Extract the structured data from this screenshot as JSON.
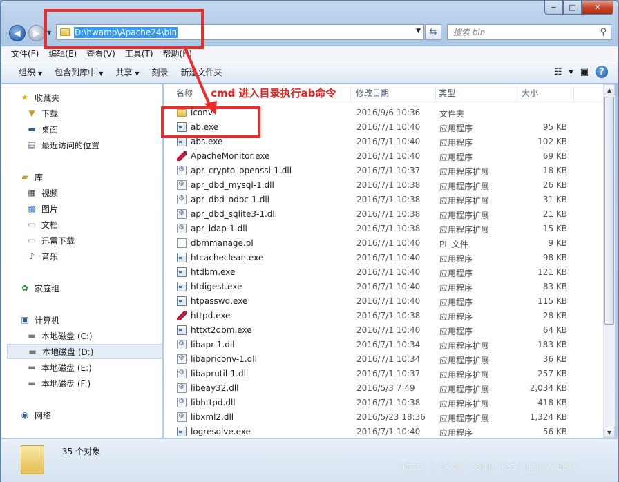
{
  "window": {
    "minimize": "‒",
    "maximize": "□",
    "close": "✕"
  },
  "address": {
    "path": "D:\\hwamp\\Apache24\\bin",
    "search_placeholder": "搜索 bin"
  },
  "menu": [
    "文件(F)",
    "编辑(E)",
    "查看(V)",
    "工具(T)",
    "帮助(H)"
  ],
  "toolbar": {
    "organize": "组织",
    "include": "包含到库中",
    "share": "共享",
    "burn": "刻录",
    "newfolder": "新建文件夹"
  },
  "sidebar": {
    "favorites": "收藏夹",
    "downloads": "下载",
    "desktop": "桌面",
    "recent": "最近访问的位置",
    "libraries": "库",
    "videos": "视频",
    "pictures": "图片",
    "documents": "文档",
    "thunder": "迅雷下载",
    "music": "音乐",
    "homegroup": "家庭组",
    "computer": "计算机",
    "disk_c": "本地磁盘 (C:)",
    "disk_d": "本地磁盘 (D:)",
    "disk_e": "本地磁盘 (E:)",
    "disk_f": "本地磁盘 (F:)",
    "network": "网络"
  },
  "columns": {
    "name": "名称",
    "date": "修改日期",
    "type": "类型",
    "size": "大小"
  },
  "files": [
    {
      "name": "iconv",
      "date": "2016/9/6 10:36",
      "type": "文件夹",
      "size": "",
      "icon": "folder"
    },
    {
      "name": "ab.exe",
      "date": "2016/7/1 10:40",
      "type": "应用程序",
      "size": "95 KB",
      "icon": "exe"
    },
    {
      "name": "abs.exe",
      "date": "2016/7/1 10:40",
      "type": "应用程序",
      "size": "102 KB",
      "icon": "exe"
    },
    {
      "name": "ApacheMonitor.exe",
      "date": "2016/7/1 10:40",
      "type": "应用程序",
      "size": "69 KB",
      "icon": "feather"
    },
    {
      "name": "apr_crypto_openssl-1.dll",
      "date": "2016/7/1 10:37",
      "type": "应用程序扩展",
      "size": "18 KB",
      "icon": "dll"
    },
    {
      "name": "apr_dbd_mysql-1.dll",
      "date": "2016/7/1 10:38",
      "type": "应用程序扩展",
      "size": "26 KB",
      "icon": "dll"
    },
    {
      "name": "apr_dbd_odbc-1.dll",
      "date": "2016/7/1 10:38",
      "type": "应用程序扩展",
      "size": "31 KB",
      "icon": "dll"
    },
    {
      "name": "apr_dbd_sqlite3-1.dll",
      "date": "2016/7/1 10:38",
      "type": "应用程序扩展",
      "size": "21 KB",
      "icon": "dll"
    },
    {
      "name": "apr_ldap-1.dll",
      "date": "2016/7/1 10:38",
      "type": "应用程序扩展",
      "size": "15 KB",
      "icon": "dll"
    },
    {
      "name": "dbmmanage.pl",
      "date": "2016/7/1 10:40",
      "type": "PL 文件",
      "size": "9 KB",
      "icon": "file"
    },
    {
      "name": "htcacheclean.exe",
      "date": "2016/7/1 10:40",
      "type": "应用程序",
      "size": "98 KB",
      "icon": "exe"
    },
    {
      "name": "htdbm.exe",
      "date": "2016/7/1 10:40",
      "type": "应用程序",
      "size": "121 KB",
      "icon": "exe"
    },
    {
      "name": "htdigest.exe",
      "date": "2016/7/1 10:40",
      "type": "应用程序",
      "size": "83 KB",
      "icon": "exe"
    },
    {
      "name": "htpasswd.exe",
      "date": "2016/7/1 10:40",
      "type": "应用程序",
      "size": "115 KB",
      "icon": "exe"
    },
    {
      "name": "httpd.exe",
      "date": "2016/7/1 10:38",
      "type": "应用程序",
      "size": "28 KB",
      "icon": "feather"
    },
    {
      "name": "httxt2dbm.exe",
      "date": "2016/7/1 10:40",
      "type": "应用程序",
      "size": "64 KB",
      "icon": "exe"
    },
    {
      "name": "libapr-1.dll",
      "date": "2016/7/1 10:34",
      "type": "应用程序扩展",
      "size": "183 KB",
      "icon": "dll"
    },
    {
      "name": "libapriconv-1.dll",
      "date": "2016/7/1 10:34",
      "type": "应用程序扩展",
      "size": "36 KB",
      "icon": "dll"
    },
    {
      "name": "libaprutil-1.dll",
      "date": "2016/7/1 10:37",
      "type": "应用程序扩展",
      "size": "257 KB",
      "icon": "dll"
    },
    {
      "name": "libeay32.dll",
      "date": "2016/5/3 7:49",
      "type": "应用程序扩展",
      "size": "2,034 KB",
      "icon": "dll"
    },
    {
      "name": "libhttpd.dll",
      "date": "2016/7/1 10:38",
      "type": "应用程序扩展",
      "size": "418 KB",
      "icon": "dll"
    },
    {
      "name": "libxml2.dll",
      "date": "2016/5/23 18:36",
      "type": "应用程序扩展",
      "size": "1,324 KB",
      "icon": "dll"
    },
    {
      "name": "logresolve.exe",
      "date": "2016/7/1 10:40",
      "type": "应用程序",
      "size": "56 KB",
      "icon": "exe"
    }
  ],
  "status": {
    "count": "35 个对象"
  },
  "annotation": "cmd 进入目录执行ab命令",
  "watermark": "http://blog.csdn.net/h330531987",
  "colors": {
    "highlight_red": "#ee2b2b",
    "selection_blue": "#3399ff"
  }
}
